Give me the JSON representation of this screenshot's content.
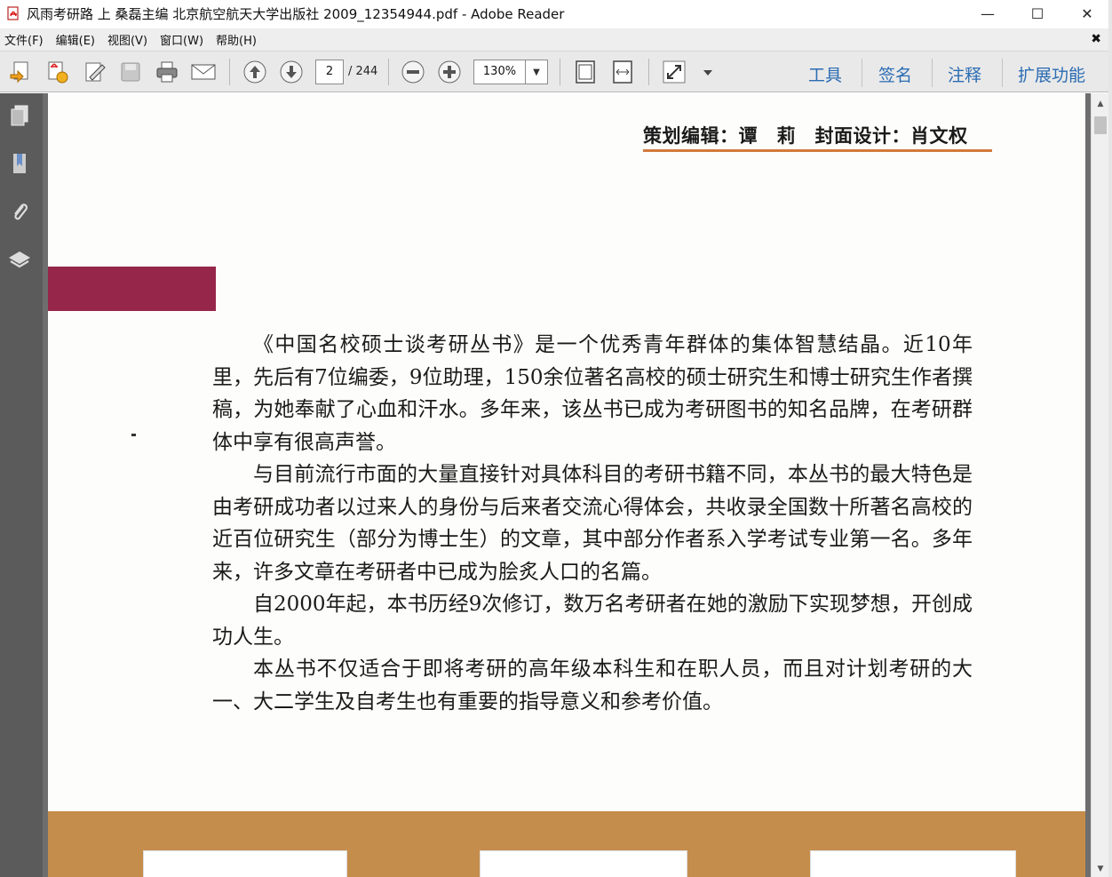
{
  "window": {
    "title": "风雨考研路 上 桑磊主编 北京航空航天大学出版社 2009_12354944.pdf - Adobe Reader",
    "minimize": "—",
    "maximize": "☐",
    "close": "✕"
  },
  "menu": {
    "items": [
      "文件(F)",
      "编辑(E)",
      "视图(V)",
      "窗口(W)",
      "帮助(H)"
    ],
    "close": "✖"
  },
  "toolbar": {
    "current_page": "2",
    "total_pages": "/ 244",
    "zoom": "130%",
    "links": [
      "工具",
      "签名",
      "注释",
      "扩展功能"
    ],
    "icons": [
      "create-pdf-icon",
      "export-pdf-icon",
      "edit-icon",
      "save-icon",
      "print-icon",
      "email-icon",
      "prev-page-icon",
      "next-page-icon",
      "zoom-out-icon",
      "zoom-in-icon",
      "fit-page-icon",
      "fit-width-icon",
      "fullscreen-icon",
      "more-tools-icon"
    ],
    "accent_color": "#2b6cb3"
  },
  "navpane": {
    "icons": [
      "pages-icon",
      "bookmarks-icon",
      "attachments-icon",
      "layers-icon"
    ]
  },
  "document": {
    "credit": "策划编辑：谭　莉　封面设计：肖文权",
    "paragraphs": [
      "《中国名校硕士谈考研丛书》是一个优秀青年群体的集体智慧结晶。近10年里，先后有7位编委，9位助理，150余位著名高校的硕士研究生和博士研究生作者撰稿，为她奉献了心血和汗水。多年来，该丛书已成为考研图书的知名品牌，在考研群体中享有很高声誉。",
      "与目前流行市面的大量直接针对具体科目的考研书籍不同，本丛书的最大特色是由考研成功者以过来人的身份与后来者交流心得体会，共收录全国数十所著名高校的近百位研究生（部分为博士生）的文章，其中部分作者系入学考试专业第一名。多年来，许多文章在考研者中已成为脍炙人口的名篇。",
      "自2000年起，本书历经9次修订，数万名考研者在她的激励下实现梦想，开创成功人生。",
      "本丛书不仅适合于即将考研的高年级本科生和在职人员，而且对计划考研的大一、大二学生及自考生也有重要的指导意义和参考价值。"
    ],
    "accent_block_color": "#96264a",
    "footer_color": "#c58d4c"
  }
}
